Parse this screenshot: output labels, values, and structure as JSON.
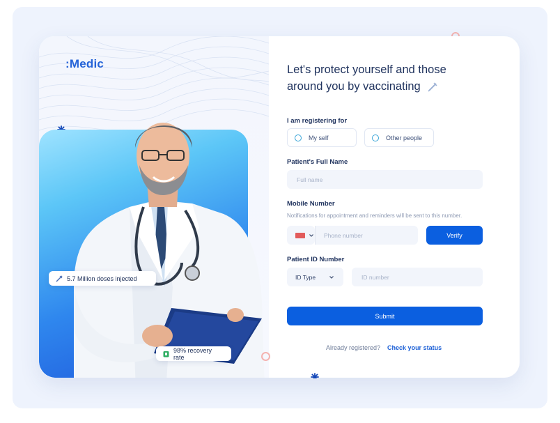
{
  "brand": {
    "logo_text": ":Medic"
  },
  "stats": {
    "doses": "5.7 Million doses injected",
    "recovery": "98% recovery rate"
  },
  "form": {
    "headline_line1": "Let's protect yourself and those",
    "headline_line2": "around you by vaccinating",
    "registering_label": "I am registering for",
    "option_self": "My self",
    "option_other": "Other people",
    "fullname_label": "Patient's Full Name",
    "fullname_placeholder": "Full name",
    "mobile_label": "Mobile Number",
    "mobile_hint": "Notifications for appointment and reminders will be sent to this number.",
    "phone_placeholder": "Phone number",
    "verify_label": "Verify",
    "id_label": "Patient ID Number",
    "id_type": "ID Type",
    "id_placeholder": "ID number",
    "submit_label": "Submit",
    "already_registered": "Already registered?",
    "check_status": "Check your status"
  },
  "colors": {
    "primary": "#0b5fe0",
    "text_dark": "#20335e",
    "star": "#1246b8"
  }
}
